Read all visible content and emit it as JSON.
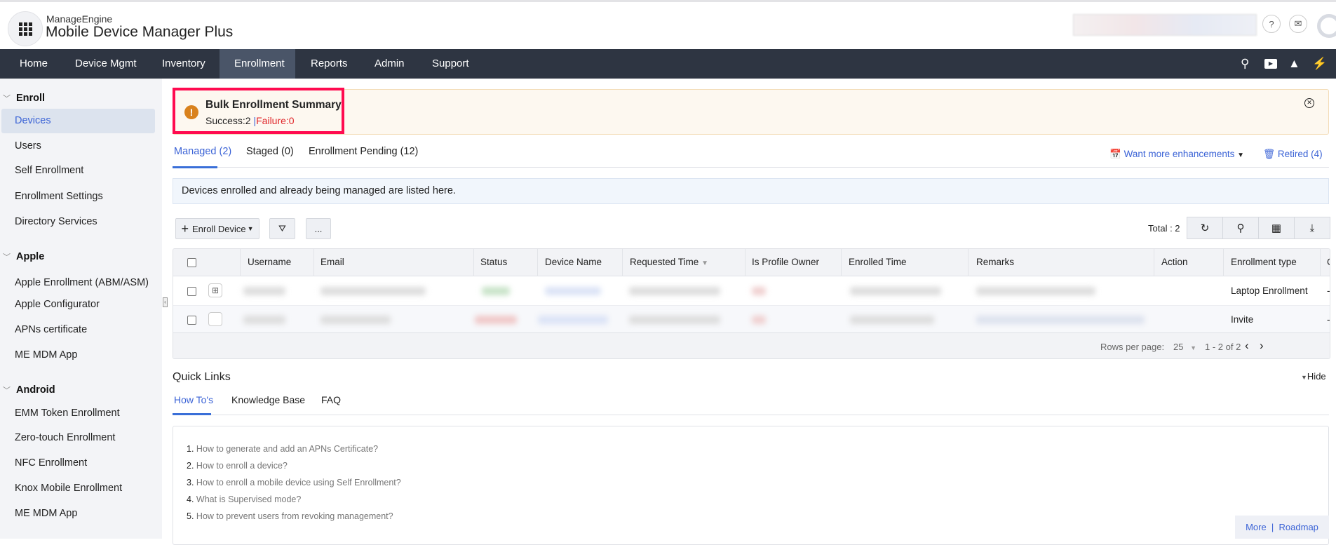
{
  "header": {
    "brand_small": "ManageEngine",
    "brand_title": "Mobile Device Manager",
    "brand_plus": "Plus"
  },
  "nav": {
    "items": [
      "Home",
      "Device Mgmt",
      "Inventory",
      "Enrollment",
      "Reports",
      "Admin",
      "Support"
    ],
    "active": "Enrollment"
  },
  "sidebar": {
    "groups": [
      {
        "label": "Enroll",
        "items": [
          "Devices",
          "Users",
          "Self Enrollment",
          "Enrollment Settings",
          "Directory Services"
        ]
      },
      {
        "label": "Apple",
        "items": [
          "Apple Enrollment (ABM/ASM)",
          "Apple Configurator",
          "APNs certificate",
          "ME MDM App"
        ]
      },
      {
        "label": "Android",
        "items": [
          "EMM Token Enrollment",
          "Zero-touch Enrollment",
          "NFC Enrollment",
          "Knox Mobile Enrollment",
          "ME MDM App"
        ]
      }
    ],
    "selected": "Devices"
  },
  "banner": {
    "title": "Bulk Enrollment Summary",
    "success": "Success:2",
    "separator": "|",
    "failure": "Failure:0"
  },
  "tabs": [
    "Managed (2)",
    "Staged (0)",
    "Enrollment Pending (12)"
  ],
  "links": {
    "enhancements": "Want more enhancements",
    "retired": "Retired (4)"
  },
  "info": "Devices enrolled and already being managed are listed here.",
  "toolbar": {
    "enroll": "Enroll Device",
    "more": "...",
    "total": "Total : 2"
  },
  "table": {
    "columns": [
      "Username",
      "Email",
      "Status",
      "Device Name",
      "Requested Time",
      "Is Profile Owner",
      "Enrolled Time",
      "Remarks",
      "Action",
      "Enrollment type",
      "C"
    ],
    "rows": [
      {
        "os": "windows",
        "enrollment_type": "Laptop Enrollment",
        "last": "-"
      },
      {
        "os": "apple",
        "enrollment_type": "Invite",
        "last": "-"
      }
    ],
    "footer": {
      "rows_label": "Rows per page:",
      "rows_value": "25",
      "range": "1 - 2 of 2"
    }
  },
  "quick_links": {
    "title": "Quick Links",
    "hide": "Hide",
    "tabs": [
      "How To's",
      "Knowledge Base",
      "FAQ"
    ],
    "items": [
      {
        "n": "1.",
        "t": "How to generate and add an APNs Certificate?"
      },
      {
        "n": "2.",
        "t": "How to enroll a device?"
      },
      {
        "n": "3.",
        "t": "How to enroll a mobile device using Self Enrollment?"
      },
      {
        "n": "4.",
        "t": "What is Supervised mode?"
      },
      {
        "n": "5.",
        "t": "How to prevent users from revoking management?"
      }
    ],
    "more": "More",
    "roadmap": "Roadmap"
  },
  "colors": {
    "nav_bg": "#2e3542",
    "accent": "#3b63d6",
    "failure": "#e0262a",
    "highlight": "#ff0b50"
  }
}
